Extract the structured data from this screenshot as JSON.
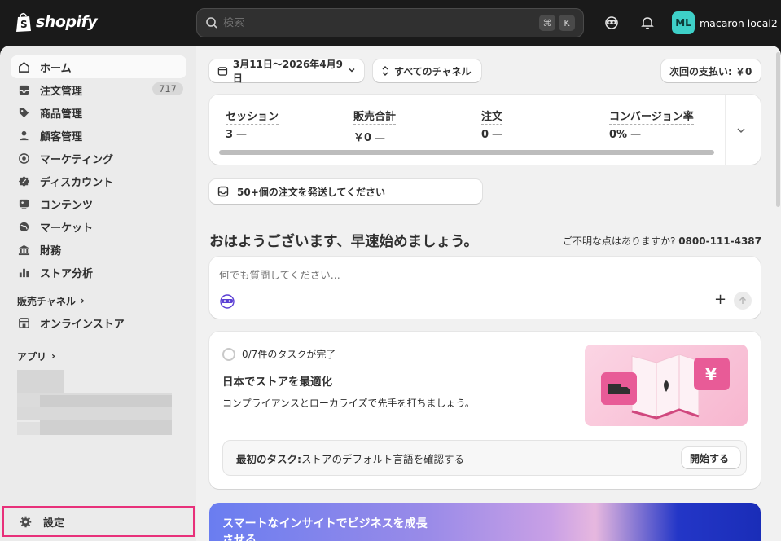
{
  "topbar": {
    "logo_text": "shopify",
    "search_placeholder": "検索",
    "kbd_cmd": "⌘",
    "kbd_k": "K",
    "account_initials": "ML",
    "account_name": "macaron local2"
  },
  "sidebar": {
    "items": [
      {
        "label": "ホーム",
        "icon": "home-icon"
      },
      {
        "label": "注文管理",
        "icon": "inbox-icon",
        "badge": "717"
      },
      {
        "label": "商品管理",
        "icon": "tag-icon"
      },
      {
        "label": "顧客管理",
        "icon": "person-icon"
      },
      {
        "label": "マーケティング",
        "icon": "target-icon"
      },
      {
        "label": "ディスカウント",
        "icon": "discount-icon"
      },
      {
        "label": "コンテンツ",
        "icon": "content-icon"
      },
      {
        "label": "マーケット",
        "icon": "globe-icon"
      },
      {
        "label": "財務",
        "icon": "bank-icon"
      },
      {
        "label": "ストア分析",
        "icon": "chart-icon"
      }
    ],
    "sales_channels_label": "販売チャネル",
    "online_store_label": "オンラインストア",
    "apps_label": "アプリ",
    "settings_label": "設定"
  },
  "main": {
    "date_range": "3月11日〜2026年4月9日",
    "channels": "すべてのチャネル",
    "next_payment": "次回の支払い: ￥0",
    "metrics": [
      {
        "label": "セッション",
        "value": "3"
      },
      {
        "label": "販売合計",
        "value": "￥0"
      },
      {
        "label": "注文",
        "value": "0"
      },
      {
        "label": "コンバージョン率",
        "value": "0%"
      }
    ],
    "metric_dash": "—",
    "orders_to_ship": "50+個の注文を発送してください",
    "greeting": "おはようございます、早速始めましょう。",
    "help_text": "ご不明な点はありますか?",
    "help_phone": "0800-111-4387",
    "ask_placeholder": "何でも質問してください...",
    "task_progress": "0/7件のタスクが完了",
    "task_title": "日本でストアを最適化",
    "task_desc": "コンプライアンスとローカライズで先手を打ちましょう。",
    "first_task_label": "最初のタスク:",
    "first_task_text": " ストアのデフォルト言語を確認する",
    "start_button": "開始する",
    "banner_text": "スマートなインサイトでビジネスを成長させる"
  }
}
